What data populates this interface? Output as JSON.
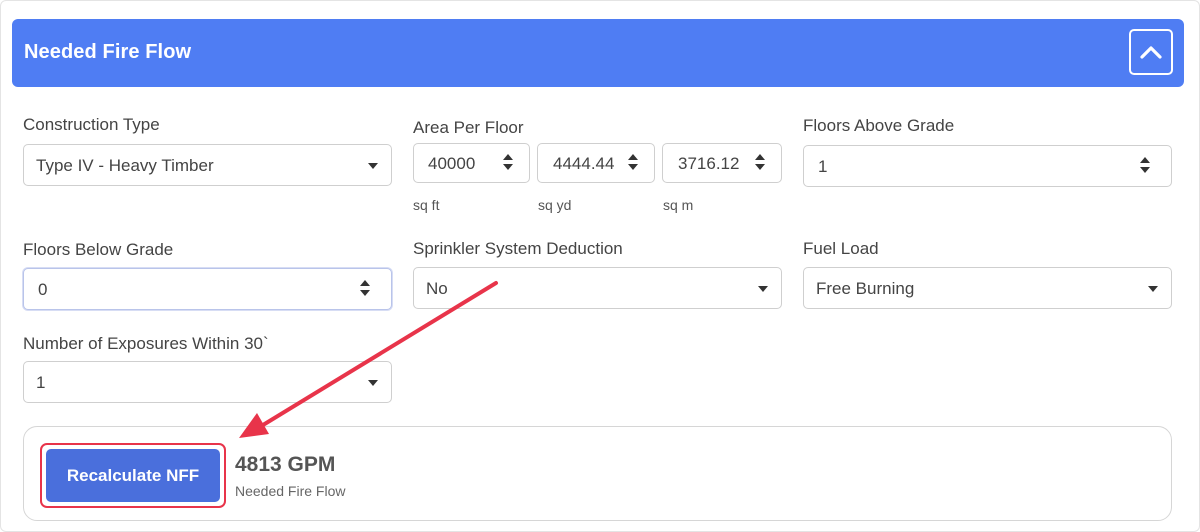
{
  "header": {
    "title": "Needed Fire Flow",
    "collapse_icon": "chevron-up-icon"
  },
  "fields": {
    "construction_type": {
      "label": "Construction Type",
      "value": "Type IV - Heavy Timber"
    },
    "area_per_floor": {
      "label": "Area Per Floor",
      "sq_ft": {
        "value": "40000",
        "unit": "sq ft"
      },
      "sq_yd": {
        "value": "4444.44",
        "unit": "sq yd"
      },
      "sq_m": {
        "value": "3716.12",
        "unit": "sq m"
      }
    },
    "floors_above_grade": {
      "label": "Floors Above Grade",
      "value": "1"
    },
    "floors_below_grade": {
      "label": "Floors Below Grade",
      "value": "0"
    },
    "sprinkler_deduction": {
      "label": "Sprinkler System Deduction",
      "value": "No"
    },
    "fuel_load": {
      "label": "Fuel Load",
      "value": "Free Burning"
    },
    "exposures": {
      "label": "Number of Exposures Within 30`",
      "value": "1"
    }
  },
  "result": {
    "button_label": "Recalculate NFF",
    "value": "4813 GPM",
    "caption": "Needed Fire Flow"
  },
  "colors": {
    "header_bg": "#4f7df3",
    "button_bg": "#4a6fdc",
    "annotation": "#e8344a"
  }
}
